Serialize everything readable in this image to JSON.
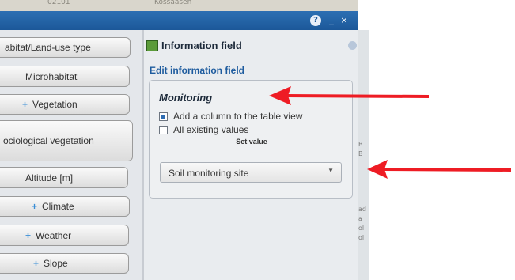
{
  "map": {
    "top_labels": [
      "02101",
      "Kossaäsén"
    ]
  },
  "window": {
    "help_icon": "?",
    "minimize_icon": "_",
    "close_icon": "×"
  },
  "left_buttons": [
    {
      "label": "abitat/Land-use type",
      "icon": ""
    },
    {
      "label": "Microhabitat",
      "icon": ""
    },
    {
      "label": "Vegetation",
      "icon": "+"
    },
    {
      "label": "ociological vegetation",
      "icon": ""
    },
    {
      "label": "Altitude [m]",
      "icon": ""
    },
    {
      "label": "Climate",
      "icon": "+"
    },
    {
      "label": "Weather",
      "icon": "+"
    },
    {
      "label": "Slope",
      "icon": "+"
    }
  ],
  "info_panel": {
    "title": "Information field",
    "edit_title": "Edit information field",
    "monitoring": {
      "title": "Monitoring",
      "options": [
        {
          "label": "Add a column to the table view",
          "checked": true
        },
        {
          "label": "All existing values",
          "checked": false
        }
      ],
      "set_value_label": "Set value",
      "select_value": "Soil monitoring site",
      "select_caret": "▼"
    }
  },
  "map_edge_labels": [
    "B",
    "B",
    "ad",
    "a",
    "ol",
    "ol"
  ],
  "colors": {
    "annotation_arrow": "#ee1c24",
    "titlebar": "#1c5899"
  }
}
